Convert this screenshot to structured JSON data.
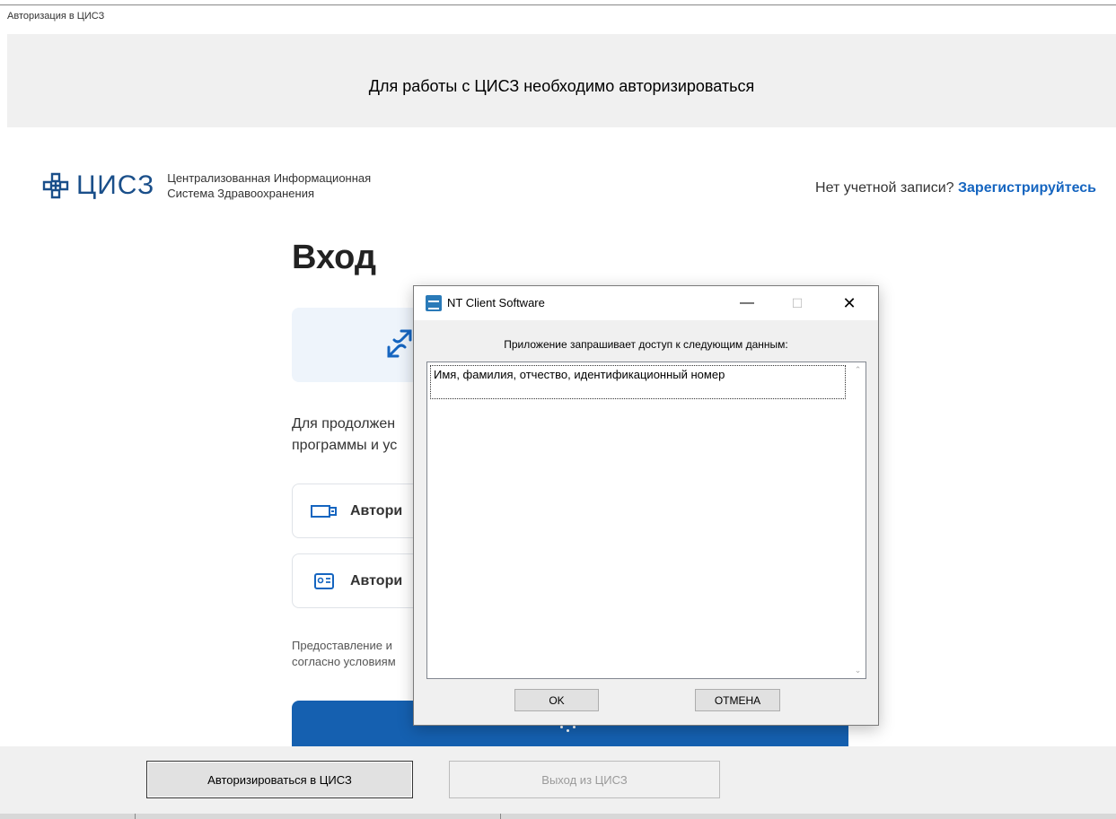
{
  "window": {
    "title": "Авторизация в ЦИСЗ"
  },
  "banner": {
    "text": "Для работы с ЦИСЗ необходимо авторизироваться"
  },
  "brand": {
    "name": "ЦИСЗ",
    "subtitle_line1": "Централизованная Информационная",
    "subtitle_line2": "Система Здравоохранения",
    "color": "#1a4f8a"
  },
  "register": {
    "prompt": "Нет учетной записи?",
    "link": "Зарегистрируйтесь"
  },
  "login": {
    "heading": "Вход",
    "continue_line1": "Для продолжен",
    "continue_line2": "программы и ус",
    "option1_label": "Автори",
    "option2_label": "Автори",
    "note_line1": "Предоставление и",
    "note_line2": "согласно условиям"
  },
  "dialog": {
    "title": "NT Client Software",
    "prompt": "Приложение запрашивает доступ к следующим данным:",
    "items": [
      "Имя, фамилия, отчество, идентификационный номер"
    ],
    "ok_label": "OK",
    "cancel_label": "ОТМЕНА"
  },
  "bottom": {
    "auth_button": "Авторизироваться в ЦИСЗ",
    "exit_button": "Выход из ЦИСЗ"
  },
  "colors": {
    "accent": "#1565c0",
    "primary_button": "#1560b0"
  }
}
